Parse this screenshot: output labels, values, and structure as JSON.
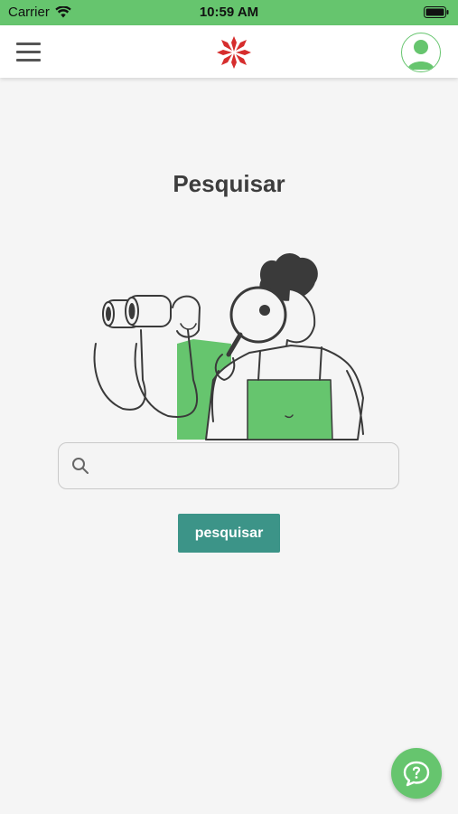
{
  "status_bar": {
    "carrier": "Carrier",
    "time": "10:59 AM"
  },
  "header": {
    "menu_icon": "hamburger-menu-icon",
    "logo": "red-star-cross-logo",
    "avatar_icon": "user-avatar-icon"
  },
  "main": {
    "title": "Pesquisar",
    "illustration": "people-searching-with-binoculars-and-magnifier",
    "search": {
      "value": "",
      "placeholder": "",
      "icon": "search-icon"
    },
    "search_button_label": "pesquisar"
  },
  "help_button": {
    "icon": "help-chat-bubble-icon"
  },
  "colors": {
    "accent_green": "#66c56e",
    "button_teal": "#3c9488",
    "title_text": "#3d3d3d",
    "logo_red": "#d62d2d"
  }
}
